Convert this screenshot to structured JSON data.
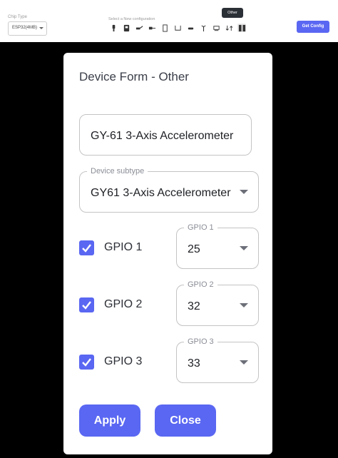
{
  "toolbar": {
    "chip_type_label": "Chip Type",
    "chip_type_value": "ESP32(4MB)",
    "config_label": "Select a New configuration",
    "icons": [
      "sensor-icon",
      "display-icon",
      "servo-icon",
      "power-icon",
      "door-icon",
      "box-icon",
      "light-icon",
      "antenna-icon",
      "board-icon",
      "swap-icon",
      "other-icon"
    ],
    "active_icon": "other-icon",
    "tooltip": "Other",
    "get_config_label": "Get Config",
    "accent_color": "#5a67f2"
  },
  "form": {
    "title": "Device Form - Other",
    "device_name": "GY-61 3-Axis Accelerometer",
    "subtype_label": "Device subtype",
    "subtype_value": "GY61 3-Axis Accelerometer",
    "gpios": [
      {
        "checkbox_label": "GPIO 1",
        "select_label": "GPIO 1",
        "value": "25",
        "checked": true
      },
      {
        "checkbox_label": "GPIO 2",
        "select_label": "GPIO 2",
        "value": "32",
        "checked": true
      },
      {
        "checkbox_label": "GPIO 3",
        "select_label": "GPIO 3",
        "value": "33",
        "checked": true
      }
    ],
    "apply_label": "Apply",
    "close_label": "Close"
  }
}
